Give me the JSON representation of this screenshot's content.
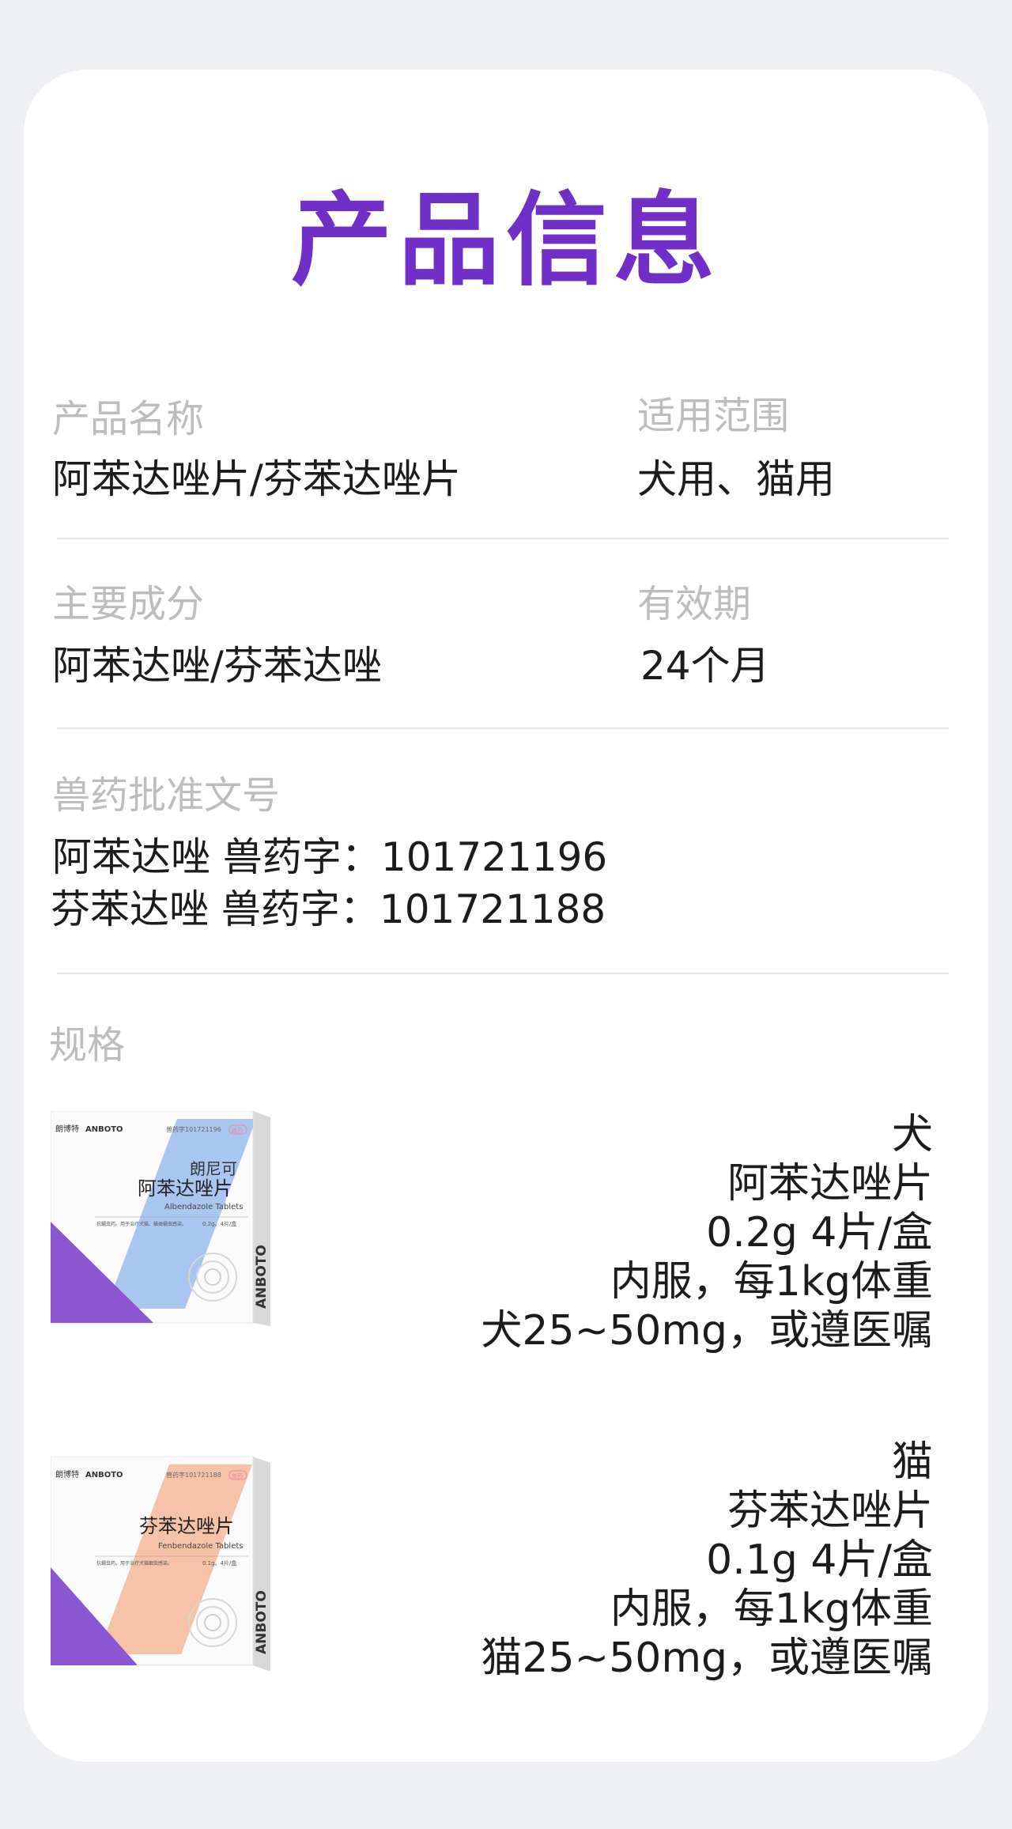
{
  "page_title": "产品信息",
  "fields": {
    "product_name_label": "产品名称",
    "product_name_value": "阿苯达唑片/芬苯达唑片",
    "scope_label": "适用范围",
    "scope_value": "犬用、猫用",
    "ingredient_label": "主要成分",
    "ingredient_value": "阿苯达唑/芬苯达唑",
    "validity_label": "有效期",
    "validity_value": "24个月",
    "approval_label": "兽药批准文号",
    "approval_line1": "阿苯达唑 兽药字：101721196",
    "approval_line2": "芬苯达唑 兽药字：101721188",
    "spec_label": "规格"
  },
  "specs": [
    {
      "animal": "犬",
      "name": "阿苯达唑片",
      "pack": "0.2g 4片/盒",
      "usage": "内服，每1kg体重",
      "dose": "犬25~50mg，或遵医嘱",
      "box": {
        "brand": "朗博特",
        "brand_en": "ANBOTO",
        "approval_no": "兽药字101721196",
        "badge": "兽药",
        "sub_brand": "朗尼可",
        "cn_name": "阿苯达唑片",
        "en_name": "Albendazole Tablets",
        "desc": "抗蠕虫药。用于治疗犬猫、猫类蠕虫感染。",
        "spec": "0.2g。4片/盒",
        "accent": "#a8c6f0",
        "triangle": "#8b56d2"
      }
    },
    {
      "animal": "猫",
      "name": "芬苯达唑片",
      "pack": "0.1g 4片/盒",
      "usage": "内服，每1kg体重",
      "dose": "猫25~50mg，或遵医嘱",
      "box": {
        "brand": "朗博特",
        "brand_en": "ANBOTO",
        "approval_no": "兽药字101721188",
        "badge": "兽药",
        "sub_brand": "",
        "cn_name": "芬苯达唑片",
        "en_name": "Fenbendazole Tablets",
        "desc": "抗蠕虫药。用于治疗犬猫蛔虫感染。",
        "spec": "0.1g。4片/盒",
        "accent": "#f6c3a8",
        "triangle": "#8b56d2"
      }
    }
  ],
  "colors": {
    "title": "#7030c8",
    "label": "#bdbdbd",
    "value": "#1c1c1c",
    "background": "#eef0f3",
    "card": "#ffffff"
  }
}
